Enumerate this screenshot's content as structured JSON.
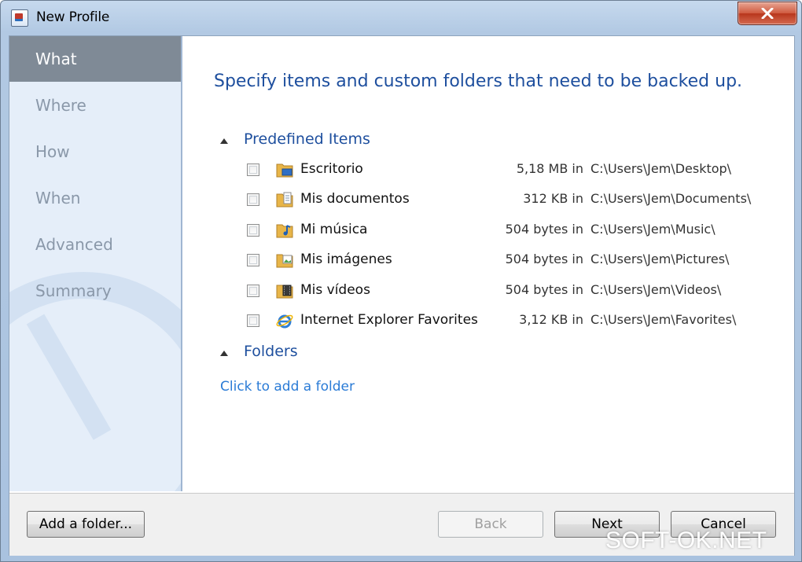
{
  "window": {
    "title": "New Profile"
  },
  "sidebar": {
    "items": [
      {
        "label": "What",
        "active": true
      },
      {
        "label": "Where",
        "active": false
      },
      {
        "label": "How",
        "active": false
      },
      {
        "label": "When",
        "active": false
      },
      {
        "label": "Advanced",
        "active": false
      },
      {
        "label": "Summary",
        "active": false
      }
    ]
  },
  "main": {
    "heading": "Specify items and custom folders that need to be backed up.",
    "predefined": {
      "label": "Predefined Items",
      "items": [
        {
          "name": "Escritorio",
          "size": "5,18 MB in",
          "path": "C:\\Users\\Jem\\Desktop\\",
          "icon": "desktop-folder-icon",
          "checked": false
        },
        {
          "name": "Mis documentos",
          "size": "312 KB in",
          "path": "C:\\Users\\Jem\\Documents\\",
          "icon": "documents-folder-icon",
          "checked": false
        },
        {
          "name": "Mi música",
          "size": "504 bytes in",
          "path": "C:\\Users\\Jem\\Music\\",
          "icon": "music-folder-icon",
          "checked": false
        },
        {
          "name": "Mis imágenes",
          "size": "504 bytes in",
          "path": "C:\\Users\\Jem\\Pictures\\",
          "icon": "pictures-folder-icon",
          "checked": false
        },
        {
          "name": "Mis vídeos",
          "size": "504 bytes in",
          "path": "C:\\Users\\Jem\\Videos\\",
          "icon": "videos-folder-icon",
          "checked": false
        },
        {
          "name": "Internet Explorer Favorites",
          "size": "3,12 KB in",
          "path": "C:\\Users\\Jem\\Favorites\\",
          "icon": "internet-explorer-icon",
          "checked": false
        }
      ]
    },
    "folders": {
      "label": "Folders",
      "add_link": "Click to add a folder"
    }
  },
  "footer": {
    "add_folder": "Add a folder...",
    "back": "Back",
    "next": "Next",
    "cancel": "Cancel"
  },
  "watermark": "SOFT-OK.NET",
  "colors": {
    "heading": "#1e4f9e",
    "link": "#2a7bd6",
    "sidebar_bg": "#e5eef9",
    "sidebar_active": "#7f8a96"
  }
}
